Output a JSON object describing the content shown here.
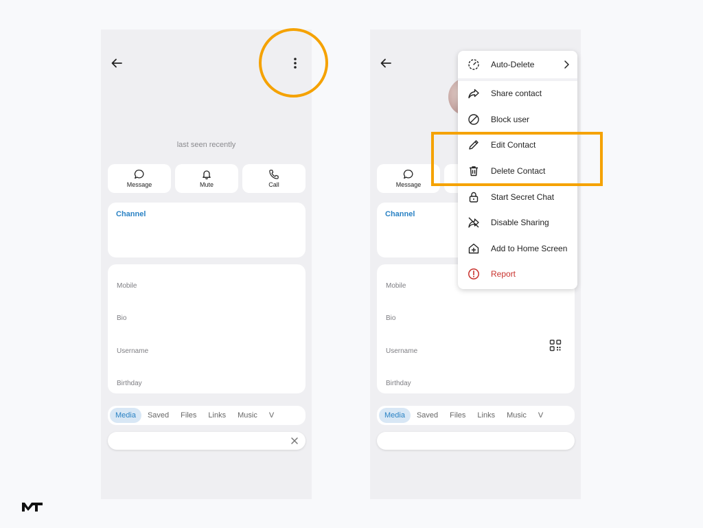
{
  "left_screen": {
    "last_seen": "last seen recently",
    "actions": [
      {
        "label": "Message",
        "icon": "message-icon"
      },
      {
        "label": "Mute",
        "icon": "bell-icon"
      },
      {
        "label": "Call",
        "icon": "phone-icon"
      }
    ],
    "channel_title": "Channel",
    "info_labels": [
      "Mobile",
      "Bio",
      "Username",
      "Birthday"
    ],
    "tabs": [
      "Media",
      "Saved",
      "Files",
      "Links",
      "Music",
      "V"
    ]
  },
  "right_screen": {
    "actions": [
      {
        "label": "Message",
        "icon": "message-icon"
      }
    ],
    "channel_title": "Channel",
    "info_labels": [
      "Mobile",
      "Bio",
      "Username",
      "Birthday"
    ],
    "tabs": [
      "Media",
      "Saved",
      "Files",
      "Links",
      "Music",
      "V"
    ],
    "menu": [
      {
        "label": "Auto-Delete",
        "icon": "timer-icon",
        "has_submenu": true
      },
      {
        "label": "Share contact",
        "icon": "share-icon"
      },
      {
        "label": "Block user",
        "icon": "block-icon"
      },
      {
        "label": "Edit Contact",
        "icon": "pencil-icon"
      },
      {
        "label": "Delete Contact",
        "icon": "trash-icon"
      },
      {
        "label": "Start Secret Chat",
        "icon": "lock-icon"
      },
      {
        "label": "Disable Sharing",
        "icon": "no-share-icon"
      },
      {
        "label": "Add to Home Screen",
        "icon": "home-add-icon"
      },
      {
        "label": "Report",
        "icon": "report-icon",
        "danger": true
      }
    ]
  },
  "colors": {
    "accent": "#2a82c4",
    "highlight": "#f5a200",
    "danger": "#c8312c",
    "panel_bg": "#efeff2"
  }
}
